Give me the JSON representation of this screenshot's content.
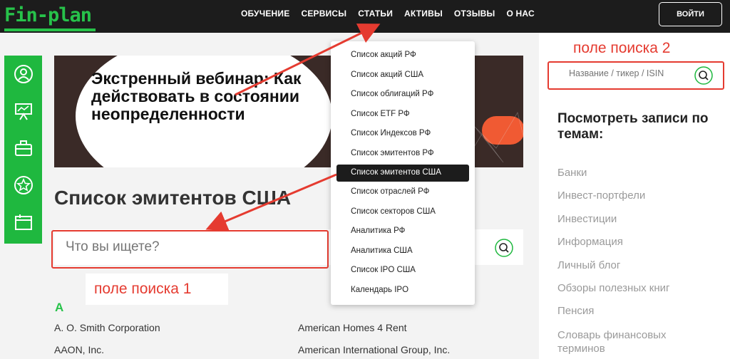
{
  "header": {
    "logo": "Fin-plan",
    "nav": [
      "ОБУЧЕНИЕ",
      "СЕРВИСЫ",
      "СТАТЬИ",
      "АКТИВЫ",
      "ОТЗЫВЫ",
      "О НАС"
    ],
    "login_label": "ВОЙТИ"
  },
  "sidebar": {
    "icons": [
      "user-icon",
      "presentation-icon",
      "briefcase-icon",
      "star-icon",
      "folder-icon"
    ]
  },
  "banner": {
    "text": "Экстренный вебинар: Как действовать в состоянии неопределенности"
  },
  "main": {
    "title": "Список эмитентов США",
    "search": {
      "placeholder": "Что вы ищете?"
    },
    "annotation_search1": "поле поиска 1",
    "letter": "A",
    "items_left": [
      "A. O. Smith Corporation",
      "AAON, Inc."
    ],
    "items_right": [
      "American Homes 4 Rent",
      "American International Group, Inc."
    ]
  },
  "dropdown": {
    "items": [
      "Список акций РФ",
      "Список акций США",
      "Список облигаций РФ",
      "Список ETF РФ",
      "Список Индексов РФ",
      "Список эмитентов РФ",
      "Список эмитентов США",
      "Список отраслей РФ",
      "Список секторов США",
      "Аналитика РФ",
      "Аналитика США",
      "Список IPO США",
      "Календарь IPO"
    ],
    "active": "Список эмитентов США"
  },
  "right": {
    "annotation_search2": "поле поиска 2",
    "search": {
      "placeholder": "Название / тикер / ISIN"
    },
    "topics_title": "Посмотреть записи по темам:",
    "topics": [
      "Банки",
      "Инвест-портфели",
      "Инвестиции",
      "Информация",
      "Личный блог",
      "Обзоры полезных книг",
      "Пенсия",
      "Словарь финансовых терминов"
    ]
  },
  "colors": {
    "accent_green": "#27c24a",
    "annotation_red": "#e53b30",
    "topbar": "#1c1c1c"
  }
}
